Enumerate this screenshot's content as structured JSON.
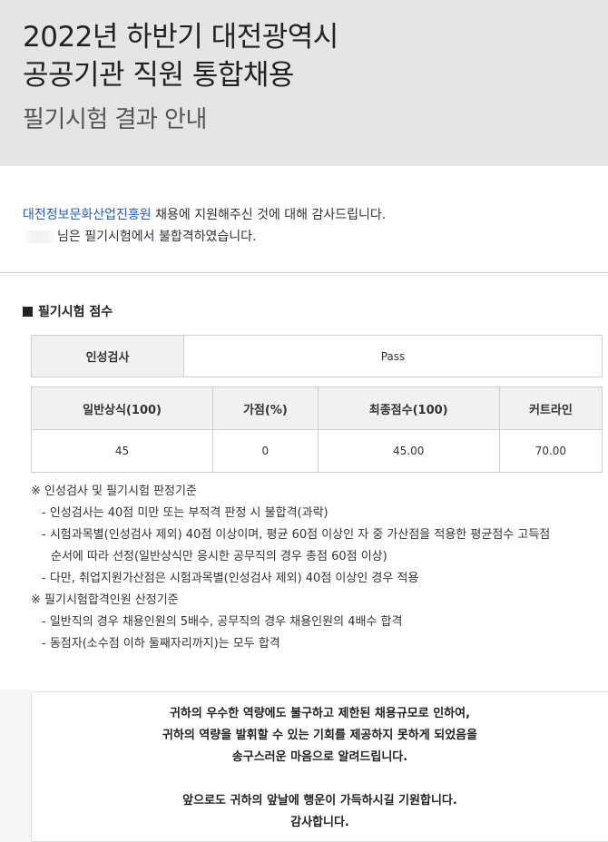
{
  "header": {
    "title_line1": "2022년 하반기 대전광역시",
    "title_line2": "공공기관 직원 통합채용",
    "subtitle": "필기시험 결과 안내"
  },
  "intro": {
    "org": "대전정보문화산업진흥원",
    "line1_rest": " 채용에 지원해주신 것에 대해 감사드립니다.",
    "line2_rest": "님은 필기시험에서 불합격하였습니다."
  },
  "score_section": {
    "title": "필기시험 점수",
    "aptitude_label": "인성검사",
    "aptitude_value": "Pass",
    "columns": [
      "일반상식(100)",
      "가점(%)",
      "최종점수(100)",
      "커트라인"
    ],
    "values": [
      "45",
      "0",
      "45.00",
      "70.00"
    ]
  },
  "notes": {
    "criteria1_title": "※ 인성검사 및 필기시험 판정기준",
    "criteria1_items": [
      "- 인성검사는 40점 미만 또는 부적격 판정 시 불합격(과락)",
      "- 시험과목별(인성검사 제외) 40점 이상이며, 평균 60점 이상인 자 중 가산점을 적용한 평균점수 고득점",
      "순서에 따라 선정(일반상식만 응시한 공무직의 경우 총점 60점 이상)",
      "- 다만, 취업지원가산점은 시험과목별(인성검사 제외) 40점 이상인 경우 적용"
    ],
    "criteria2_title": "※ 필기시험합격인원 산정기준",
    "criteria2_items": [
      "- 일반직의 경우 채용인원의 5배수, 공무직의 경우 채용인원의 4배수 합격",
      "- 동점자(소수점 이하 둘째자리까지)는 모두 합격"
    ]
  },
  "message": {
    "line1": "귀하의 우수한 역량에도 불구하고 제한된 채용규모로 인하여,",
    "line2": "귀하의 역량을 발휘할 수 있는 기회를 제공하지 못하게 되었음을",
    "line3": "송구스러운 마음으로 알려드립니다.",
    "line4": "앞으로도 귀하의 앞날에 행운이 가득하시길 기원합니다.",
    "line5": "감사합니다."
  }
}
